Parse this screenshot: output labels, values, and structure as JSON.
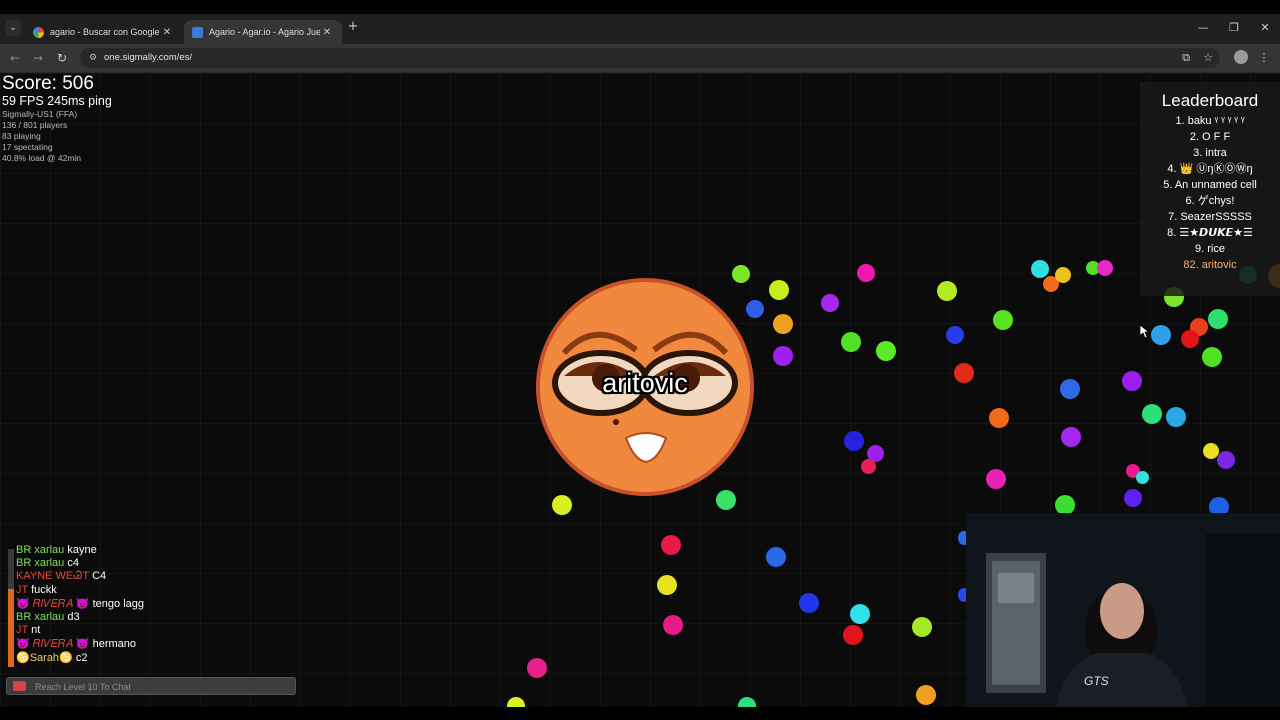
{
  "browser": {
    "tabs": [
      {
        "title": "agario - Buscar con Google",
        "active": false,
        "favicon": "google-icon"
      },
      {
        "title": "Agario - Agar.io - Agario Juegos",
        "active": true,
        "favicon": "sigmally-icon"
      }
    ],
    "url": "one.sigmally.com/es/"
  },
  "hud": {
    "score": "Score: 506",
    "fps_ping": "59 FPS 245ms ping",
    "server": "Sigmally-US1 (FFA)",
    "players": "136 / 801 players",
    "playing": "83 playing",
    "spectating": "17 spectating",
    "load": "40.8% load @ 42min"
  },
  "player": {
    "name": "aritovic",
    "color": "#f0893d"
  },
  "leaderboard": {
    "title": "Leaderboard",
    "entries": [
      "1. baku ᵞ ᵞ ᵞ ᵞ ᵞ",
      "2. O F F",
      "3. intra",
      "4. 👑 ⓊŋⓀⓄⓌŋ",
      "5. An unnamed cell",
      "6. ゲchys!",
      "7. SeazerSSSSS",
      "8. ☰★𝘿𝙐𝙆𝙀★☰",
      "9. rice"
    ],
    "self": "82. aritovic"
  },
  "chat": {
    "messages": [
      {
        "name": "BR xarlau",
        "name_color": "#7ee05a",
        "text": "kayne"
      },
      {
        "name": "BR xarlau",
        "name_color": "#7ee05a",
        "text": "c4"
      },
      {
        "name": "KAYNE WEᏊT",
        "name_color": "#e04a3a",
        "text": "C4"
      },
      {
        "name": "JT",
        "name_color": "#e0443a",
        "text": "fuckk"
      },
      {
        "name": "😈 𝑅𝐼𝑉𝐸𝑅𝐴 😈",
        "name_color": "#e0443a",
        "text": "tengo lagg"
      },
      {
        "name": "BR xarlau",
        "name_color": "#7ee05a",
        "text": "d3"
      },
      {
        "name": "JT",
        "name_color": "#e0443a",
        "text": "nt"
      },
      {
        "name": "😈 𝑅𝐼𝑉𝐸𝑅𝐴 😈",
        "name_color": "#e0443a",
        "text": "hermano"
      },
      {
        "name": "♋Sarah♋",
        "name_color": "#e8d070",
        "text": "c2"
      }
    ],
    "input_placeholder": "Reach Level 10 To Chat"
  },
  "webcam": {
    "shirt_text": "GTS"
  }
}
